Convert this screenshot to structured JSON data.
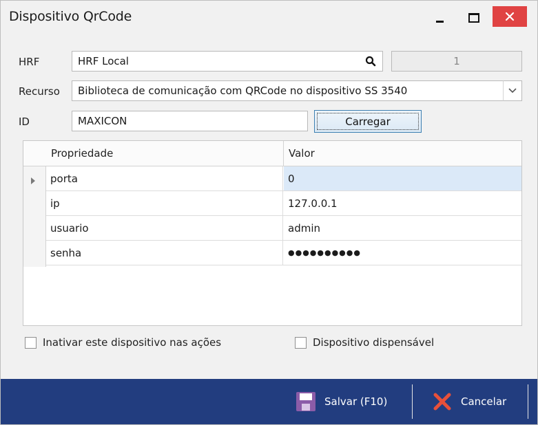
{
  "window": {
    "title": "Dispositivo QrCode"
  },
  "form": {
    "hrf_label": "HRF",
    "hrf_value": "HRF Local",
    "hrf_number": "1",
    "recurso_label": "Recurso",
    "recurso_value": "Biblioteca de comunicação com QRCode no dispositivo SS 3540",
    "id_label": "ID",
    "id_value": "MAXICON",
    "carregar_label": "Carregar"
  },
  "grid": {
    "headers": [
      "Propriedade",
      "Valor"
    ],
    "rows": [
      {
        "prop": "porta",
        "value": "0"
      },
      {
        "prop": "ip",
        "value": "127.0.0.1"
      },
      {
        "prop": "usuario",
        "value": "admin"
      },
      {
        "prop": "senha",
        "value": "●●●●●●●●●●"
      }
    ]
  },
  "options": {
    "inativar_label": "Inativar este dispositivo nas ações",
    "dispensavel_label": "Dispositivo dispensável"
  },
  "footer": {
    "save_label": "Salvar (F10)",
    "cancel_label": "Cancelar"
  },
  "colors": {
    "footer_bg": "#223d7f",
    "close_button": "#e04343",
    "selected_cell": "#dbe9f8"
  }
}
